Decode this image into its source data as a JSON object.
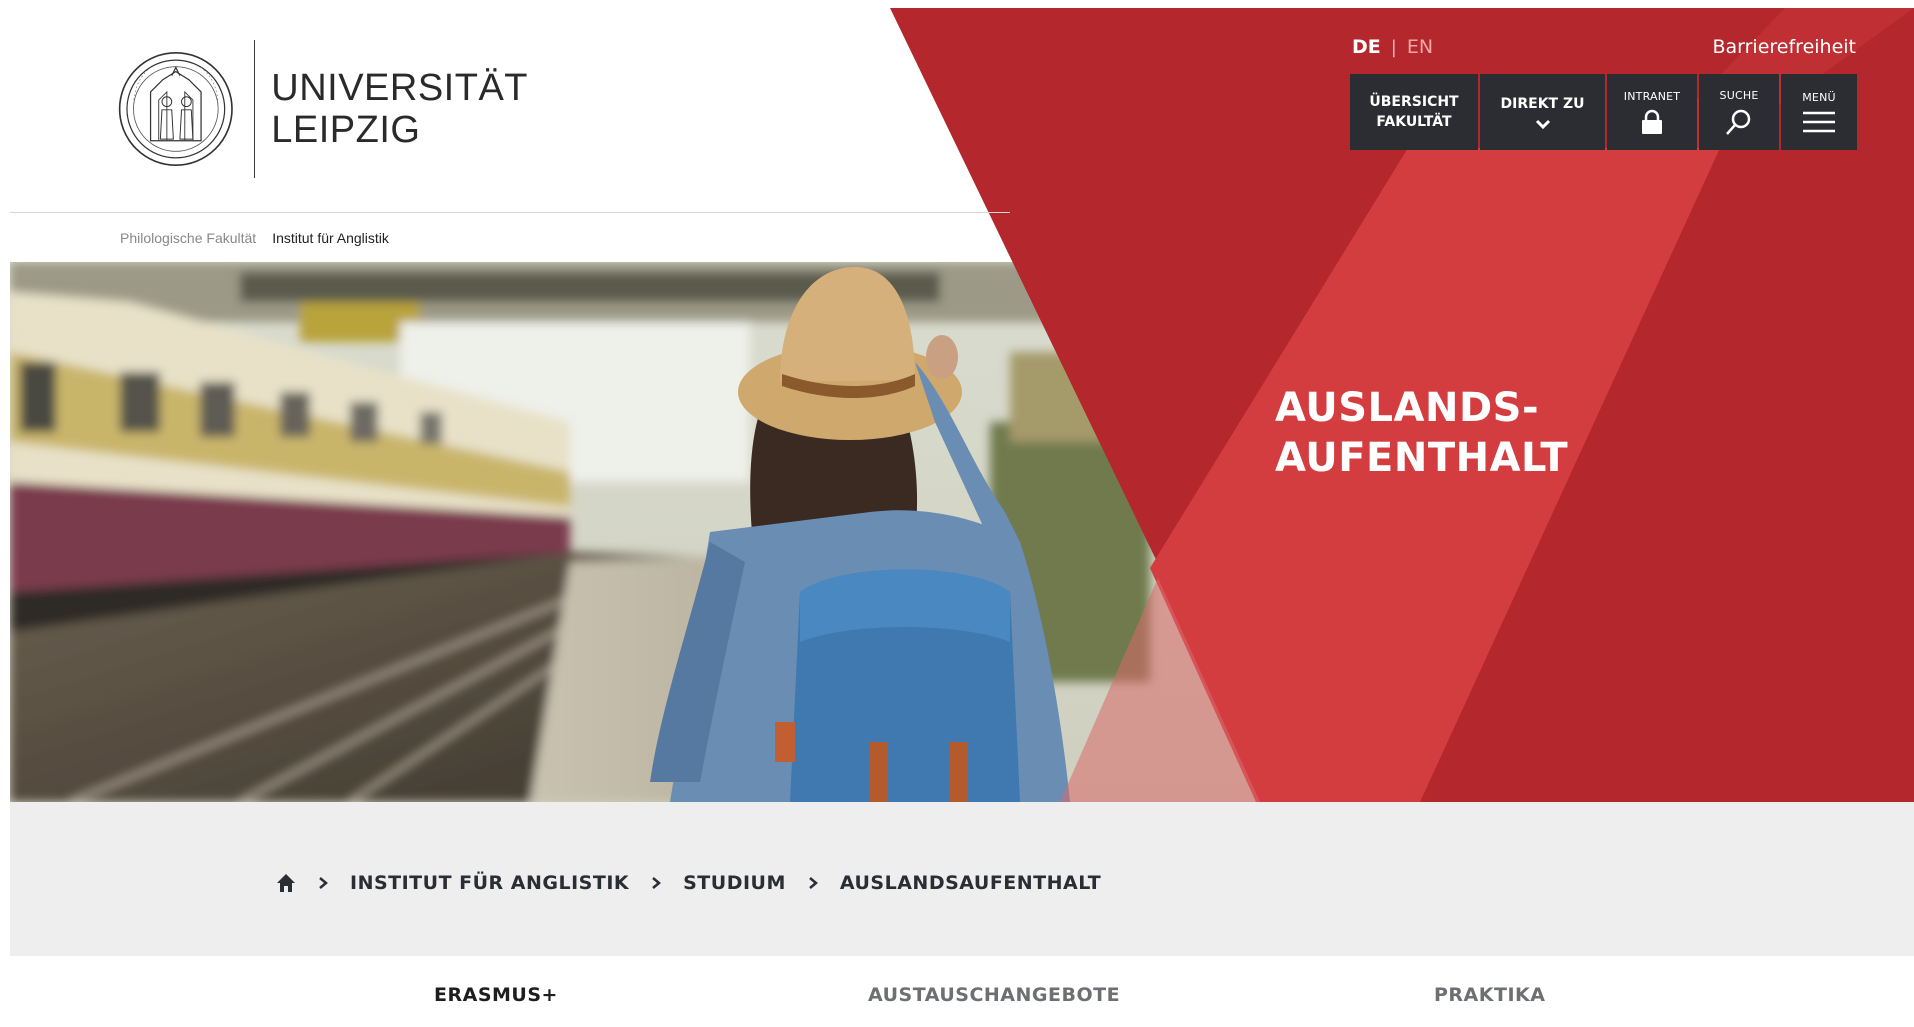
{
  "logo": {
    "line1": "UNIVERSITÄT",
    "line2": "LEIPZIG",
    "seal_icon": "university-seal-icon"
  },
  "top_breadcrumb": {
    "faculty": "Philologische Fakultät",
    "institute": "Institut für Anglistik"
  },
  "language": {
    "de": "DE",
    "separator": "|",
    "en": "EN",
    "active": "DE"
  },
  "accessibility_link": "Barrierefreiheit",
  "nav": {
    "overview_line1": "ÜBERSICHT",
    "overview_line2": "FAKULTÄT",
    "direct": "DIREKT ZU",
    "intranet": "INTRANET",
    "search": "SUCHE",
    "menu": "MENÜ"
  },
  "hero": {
    "title_line1": "AUSLANDS-",
    "title_line2": "AUFENTHALT"
  },
  "breadcrumb": {
    "home_icon": "home-icon",
    "items": [
      "INSTITUT FÜR ANGLISTIK",
      "STUDIUM",
      "AUSLANDSAUFENTHALT"
    ]
  },
  "subnav": {
    "items": [
      "ERASMUS+",
      "AUSTAUSCHANGEBOTE",
      "PRAKTIKA"
    ],
    "active": "ERASMUS+"
  },
  "colors": {
    "red_dark": "#b4282d",
    "red_light": "#d43d40",
    "nav_dark": "#2b2d33",
    "band_gray": "#eeeeee"
  }
}
